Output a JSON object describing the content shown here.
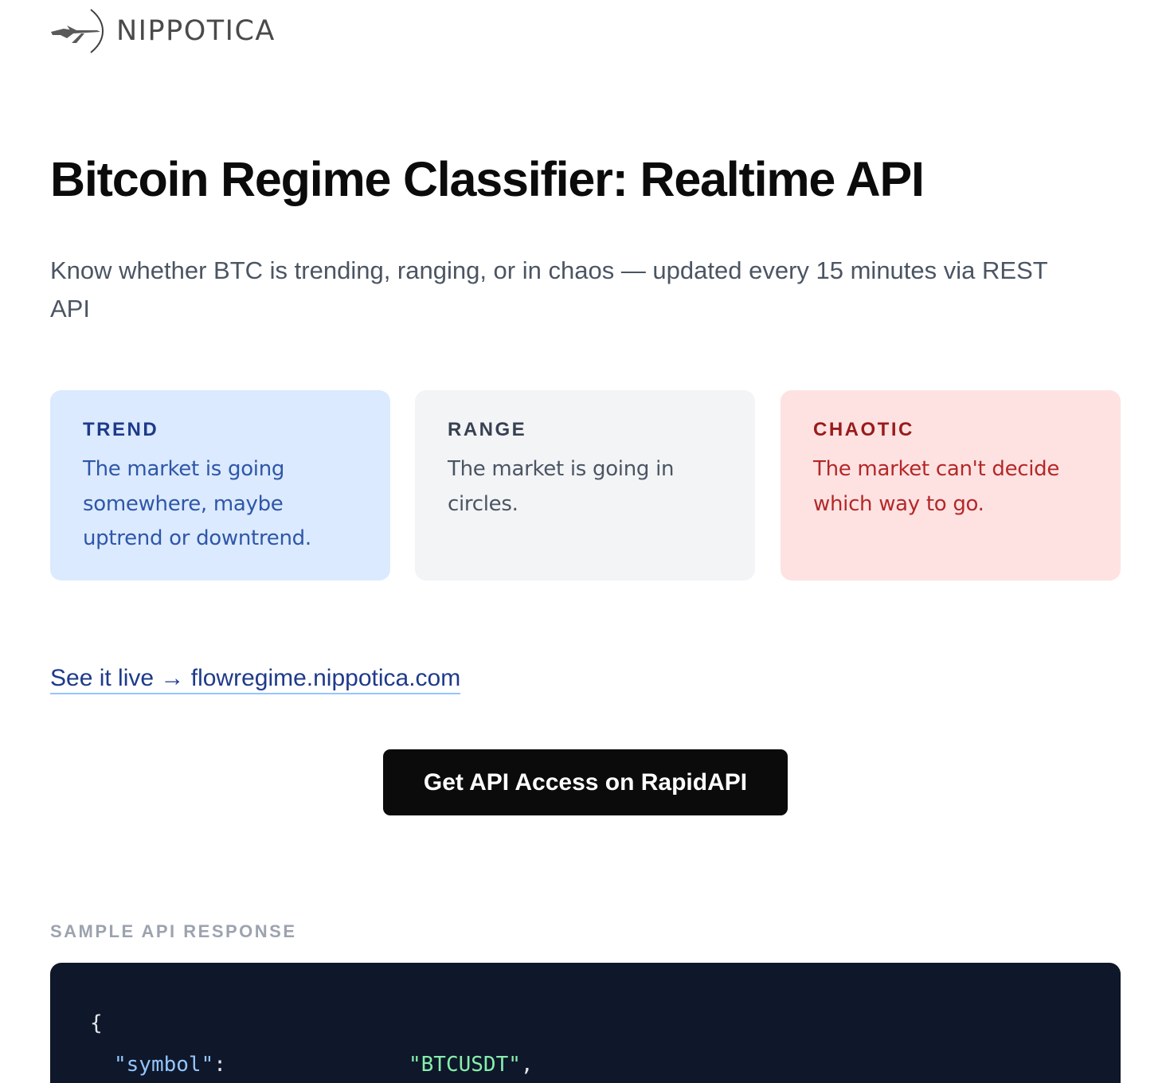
{
  "brand": {
    "name": "NIPPOTICA",
    "logo_icon": "crossbow-arrow-icon"
  },
  "hero": {
    "title": "Bitcoin Regime Classifier: Realtime API",
    "subtitle": "Know whether BTC is trending, ranging, or in chaos — updated every 15 minutes via REST API"
  },
  "regimes": [
    {
      "title": "TREND",
      "description": "The market is going somewhere, maybe uptrend or downtrend.",
      "bg_color": "#dbeafe",
      "text_color": "#1e3a8a"
    },
    {
      "title": "RANGE",
      "description": "The market is going in circles.",
      "bg_color": "#f3f4f6",
      "text_color": "#374151"
    },
    {
      "title": "CHAOTIC",
      "description": "The market can't decide which way to go.",
      "bg_color": "#fee2e2",
      "text_color": "#991b1b"
    }
  ],
  "live_link": {
    "label": "See it live → flowregime.nippotica.com"
  },
  "cta": {
    "label": "Get API Access on RapidAPI"
  },
  "sample": {
    "label": "SAMPLE API RESPONSE",
    "open_brace": "{",
    "lines": [
      {
        "key": "\"symbol\"",
        "colon": ":",
        "value": "\"BTCUSDT\"",
        "trail": ","
      }
    ]
  },
  "colors": {
    "code_background": "#0f172a",
    "code_key": "#93c5fd",
    "code_value": "#86efac",
    "cta_background": "#0b0b0b",
    "link": "#1e3a8a"
  }
}
